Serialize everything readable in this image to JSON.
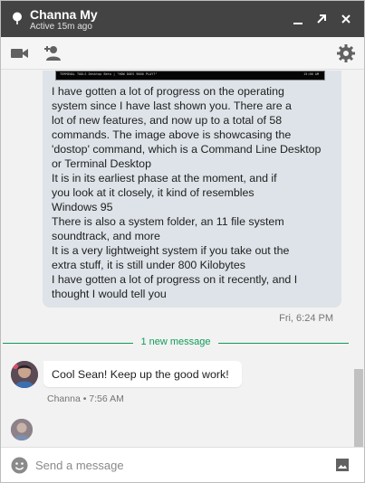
{
  "header": {
    "contact_name": "Channa My",
    "status": "Active 15m ago"
  },
  "outgoing_message": {
    "image_caption_left": "TERMINAL  TOOLS  Desktop Beta  |  \"HOW DOES 9800 PLAY?\"",
    "image_caption_right": "15:00 AM",
    "lines": [
      "I have gotten a lot of progress on the operating",
      "system since I have last shown you. There are a",
      "lot of new features, and now up to a total of 58",
      "commands. The image above is showcasing the",
      "'dostop' command, which is a Command Line Desktop",
      "or Terminal Desktop",
      "It is in its earliest phase at the moment, and if",
      "you look at it closely, it kind of resembles",
      "Windows 95",
      "There is also a system folder, an 11 file system",
      "soundtrack, and more",
      "It is a very lightweight system if you take out the",
      "extra stuff, it is still under 800 Kilobytes",
      "I have gotten a lot of progress on it recently, and I",
      "thought I would tell you"
    ],
    "timestamp": "Fri, 6:24 PM"
  },
  "new_message_divider": "1 new message",
  "incoming_message": {
    "text": "Cool Sean! Keep up the good work!",
    "meta": "Channa • 7:56 AM"
  },
  "composer": {
    "placeholder": "Send a message",
    "value": ""
  },
  "colors": {
    "titlebar": "#434343",
    "outgoing_bubble": "#dde3e8",
    "accent_green": "#0f9d58",
    "pane_background": "#f2f2f2"
  },
  "icons": {
    "status": "status-dot-icon",
    "minimize": "minimize-icon",
    "popout": "popout-icon",
    "close": "close-icon",
    "video": "video-camera-icon",
    "add_person": "add-person-icon",
    "settings": "gear-icon",
    "emoji": "emoji-icon",
    "image": "image-icon"
  }
}
